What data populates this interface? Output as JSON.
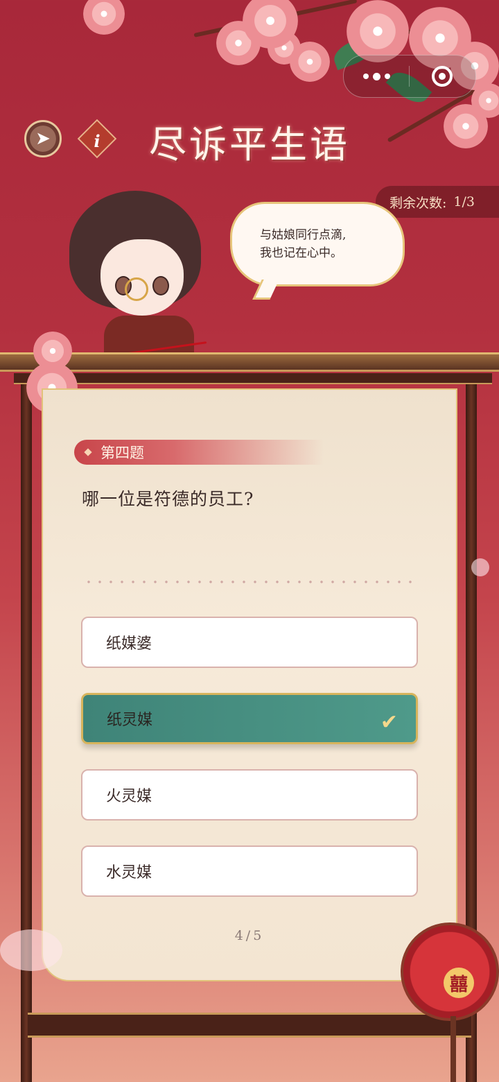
{
  "header": {
    "title": "尽诉平生语",
    "back_icon": "back-arrow-icon",
    "info_icon": "info-icon",
    "info_glyph": "i"
  },
  "capsule": {
    "more_icon": "more-dots-icon",
    "close_icon": "target-close-icon"
  },
  "remaining": {
    "label": "剩余次数:",
    "value": "1/3"
  },
  "speech": {
    "line1": "与姑娘同行点滴,",
    "line2": "我也记在心中。"
  },
  "quiz": {
    "question_label": "第四题",
    "question": "哪一位是符德的员工?",
    "options": [
      {
        "label": "纸媒婆",
        "selected": false
      },
      {
        "label": "纸灵媒",
        "selected": true
      },
      {
        "label": "火灵媒",
        "selected": false
      },
      {
        "label": "水灵媒",
        "selected": false
      }
    ],
    "check_glyph": "✔",
    "pager": "4/5"
  },
  "decor": {
    "fan_symbol": "囍"
  },
  "colors": {
    "background": "#b3303f",
    "selected_option": "#4f9a8a",
    "accent_gold": "#e2c27a"
  }
}
